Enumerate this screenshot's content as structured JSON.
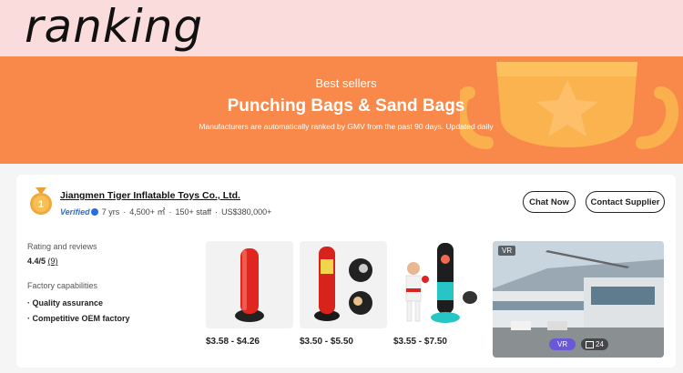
{
  "header": {
    "ranking_word": "ranking"
  },
  "banner": {
    "subtitle": "Best sellers",
    "title": "Punching Bags & Sand Bags",
    "description": "Manufacturers are automatically ranked by GMV from the past 90 days. Updated daily"
  },
  "supplier": {
    "rank": "1",
    "name": "Jiangmen Tiger Inflatable Toys Co., Ltd.",
    "verified_label": "Verified",
    "years": "7 yrs",
    "area": "4,500+ ㎡",
    "staff": "150+ staff",
    "revenue": "US$380,000+",
    "separator": "·",
    "chat_label": "Chat Now",
    "contact_label": "Contact Supplier",
    "rating_heading": "Rating and reviews",
    "rating_score": "4.4/5",
    "rating_count": "(9)",
    "capabilities_heading": "Factory capabilities",
    "capabilities": [
      "· Quality assurance",
      "· Competitive OEM factory"
    ],
    "products": [
      {
        "price": "$3.58 - $4.26"
      },
      {
        "price": "$3.50 - $5.50"
      },
      {
        "price": "$3.55 - $7.50"
      }
    ],
    "factory_media": {
      "vr_tag": "VR",
      "vr_button": "VR",
      "image_count": "24"
    }
  },
  "colors": {
    "banner": "#f8894a",
    "top_band": "#fadcdc",
    "verified": "#2b6fd6",
    "vr_pill": "#6b57d9"
  }
}
